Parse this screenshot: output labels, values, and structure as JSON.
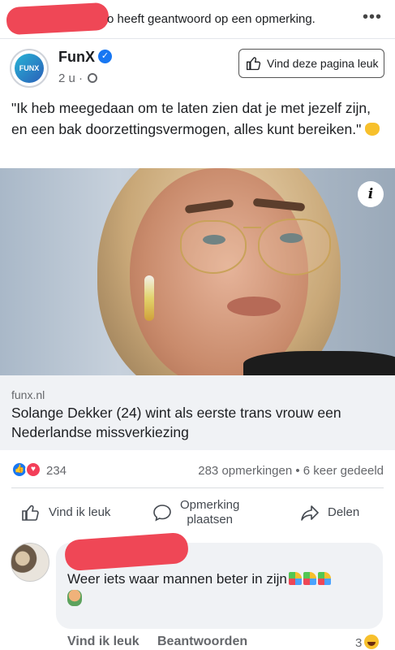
{
  "notification": {
    "text": "o heeft geantwoord op een opmerking.",
    "more_icon": "more-dots-icon"
  },
  "page": {
    "name": "FunX",
    "avatar_text": "FUNX",
    "verified_icon": "verified-check-icon",
    "time": "2 u ·",
    "privacy_icon": "globe-icon",
    "like_page_label": "Vind deze pagina leuk"
  },
  "post": {
    "text": "\"Ik heb meegedaan om te laten zien dat je met jezelf zijn, en een bak doorzettingsvermogen, alles kunt bereiken.\""
  },
  "link": {
    "domain": "funx.nl",
    "headline": "Solange Dekker (24) wint als eerste trans vrouw een Nederlandse missverkiezing",
    "info_icon": "i"
  },
  "stats": {
    "reaction_count": "234",
    "comments_shares": "283 opmerkingen • 6 keer gedeeld"
  },
  "actions": {
    "like": "Vind ik leuk",
    "comment_line1": "Opmerking",
    "comment_line2": "plaatsen",
    "share": "Delen"
  },
  "comment": {
    "text": "Weer iets waar mannen beter in zijn",
    "like": "Vind ik leuk",
    "reply": "Beantwoorden",
    "reaction_count": "3"
  },
  "colors": {
    "accent": "#1877f2",
    "love": "#f33e58",
    "redaction": "#ef4756"
  }
}
